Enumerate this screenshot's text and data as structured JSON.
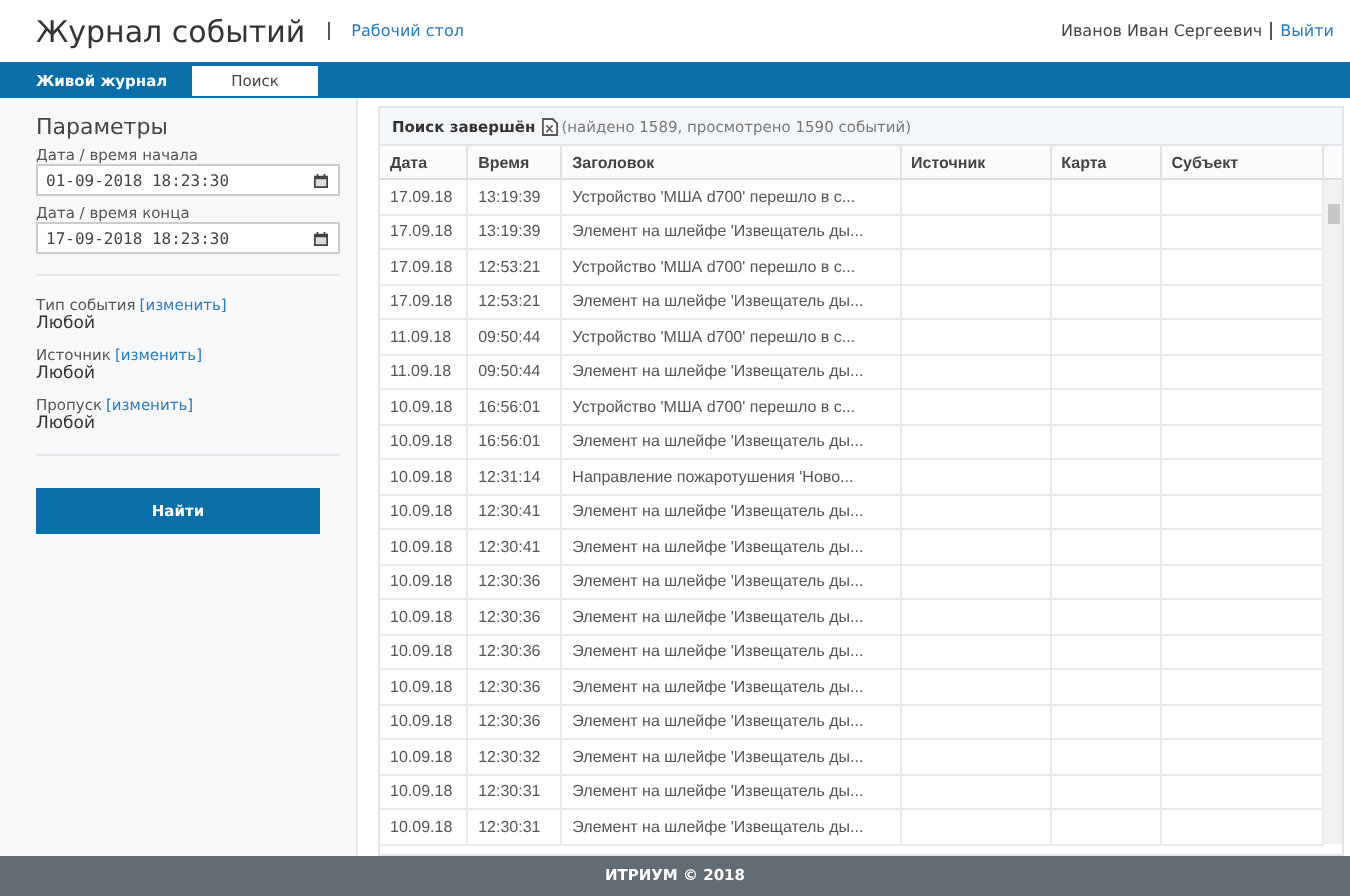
{
  "header": {
    "title": "Журнал событий",
    "link": "Рабочий стол",
    "user": "Иванов Иван Сергеевич",
    "logout": "Выйти"
  },
  "tabs": [
    {
      "label": "Живой журнал",
      "selected": false
    },
    {
      "label": "Поиск",
      "selected": true
    }
  ],
  "params": {
    "title": "Параметры",
    "fields": [
      {
        "label": "Дата / время начала",
        "value": "01-09-2018 18:23:30"
      },
      {
        "label": "Дата / время конца",
        "value": "17-09-2018 18:23:30"
      }
    ],
    "filters": [
      {
        "label": "Тип события",
        "link": "[изменить]",
        "value": "Любой"
      },
      {
        "label": "Источник",
        "link": "[изменить]",
        "value": "Любой"
      },
      {
        "label": "Пропуск",
        "link": "[изменить]",
        "value": "Любой"
      }
    ],
    "button": "Найти"
  },
  "results": {
    "status": "Поиск завершён",
    "summary": "(найдено 1589, просмотрено 1590 событий)",
    "columns": [
      "Дата",
      "Время",
      "Заголовок",
      "Источник",
      "Карта",
      "Субъект"
    ],
    "rows": [
      [
        "17.09.18",
        "13:19:39",
        "Устройство 'МША d700' перешло в с..."
      ],
      [
        "17.09.18",
        "13:19:39",
        "Элемент на шлейфе 'Извещатель ды..."
      ],
      [
        "17.09.18",
        "12:53:21",
        "Устройство 'МША d700' перешло в с..."
      ],
      [
        "17.09.18",
        "12:53:21",
        "Элемент на шлейфе 'Извещатель ды..."
      ],
      [
        "11.09.18",
        "09:50:44",
        "Устройство 'МША d700' перешло в с..."
      ],
      [
        "11.09.18",
        "09:50:44",
        "Элемент на шлейфе 'Извещатель ды..."
      ],
      [
        "10.09.18",
        "16:56:01",
        "Устройство 'МША d700' перешло в с..."
      ],
      [
        "10.09.18",
        "16:56:01",
        "Элемент на шлейфе 'Извещатель ды..."
      ],
      [
        "10.09.18",
        "12:31:14",
        "Направление пожаротушения 'Ново..."
      ],
      [
        "10.09.18",
        "12:30:41",
        "Элемент на шлейфе 'Извещатель ды..."
      ],
      [
        "10.09.18",
        "12:30:41",
        "Элемент на шлейфе 'Извещатель ды..."
      ],
      [
        "10.09.18",
        "12:30:36",
        "Элемент на шлейфе 'Извещатель ды..."
      ],
      [
        "10.09.18",
        "12:30:36",
        "Элемент на шлейфе 'Извещатель ды..."
      ],
      [
        "10.09.18",
        "12:30:36",
        "Элемент на шлейфе 'Извещатель ды..."
      ],
      [
        "10.09.18",
        "12:30:36",
        "Элемент на шлейфе 'Извещатель ды..."
      ],
      [
        "10.09.18",
        "12:30:36",
        "Элемент на шлейфе 'Извещатель ды..."
      ],
      [
        "10.09.18",
        "12:30:32",
        "Элемент на шлейфе 'Извещатель ды..."
      ],
      [
        "10.09.18",
        "12:30:31",
        "Элемент на шлейфе 'Извещатель ды..."
      ],
      [
        "10.09.18",
        "12:30:31",
        "Элемент на шлейфе 'Извещатель ды..."
      ]
    ]
  },
  "footer": "ИТРИУМ © 2018"
}
